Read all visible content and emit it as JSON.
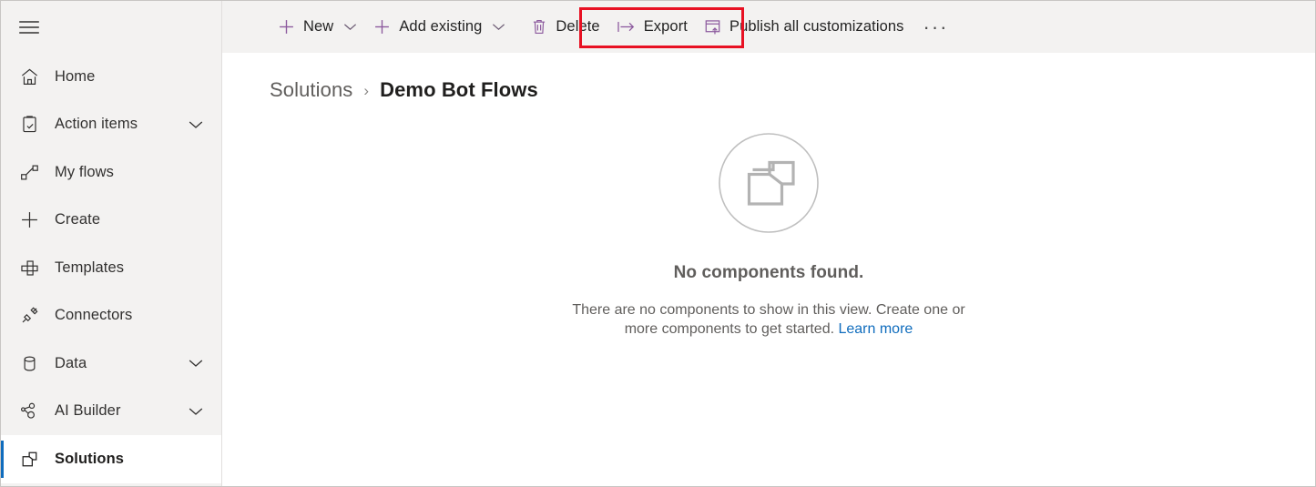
{
  "sidebar": {
    "menu_button": "hamburger-menu",
    "items": [
      {
        "label": "Home",
        "icon": "home-icon",
        "expandable": false,
        "selected": false
      },
      {
        "label": "Action items",
        "icon": "clipboard-check-icon",
        "expandable": true,
        "selected": false
      },
      {
        "label": "My flows",
        "icon": "flow-icon",
        "expandable": false,
        "selected": false
      },
      {
        "label": "Create",
        "icon": "plus-icon",
        "expandable": false,
        "selected": false
      },
      {
        "label": "Templates",
        "icon": "templates-icon",
        "expandable": false,
        "selected": false
      },
      {
        "label": "Connectors",
        "icon": "connectors-icon",
        "expandable": false,
        "selected": false
      },
      {
        "label": "Data",
        "icon": "database-icon",
        "expandable": true,
        "selected": false
      },
      {
        "label": "AI Builder",
        "icon": "ai-builder-icon",
        "expandable": true,
        "selected": false
      },
      {
        "label": "Solutions",
        "icon": "solutions-icon",
        "expandable": false,
        "selected": true
      }
    ]
  },
  "toolbar": {
    "new_label": "New",
    "add_existing_label": "Add existing",
    "delete_label": "Delete",
    "export_label": "Export",
    "publish_label": "Publish all customizations",
    "overflow_label": "···"
  },
  "breadcrumb": {
    "parent": "Solutions",
    "separator": "›",
    "current": "Demo Bot Flows"
  },
  "empty_state": {
    "title": "No components found.",
    "description": "There are no components to show in this view. Create one or more components to get started.",
    "link_label": "Learn more"
  },
  "colors": {
    "accent_purple": "#8c5a9e",
    "highlight_red": "#e81123",
    "link_blue": "#0f6cbd",
    "selected_indicator": "#0f6cbd",
    "chrome_gray": "#f3f2f1"
  }
}
